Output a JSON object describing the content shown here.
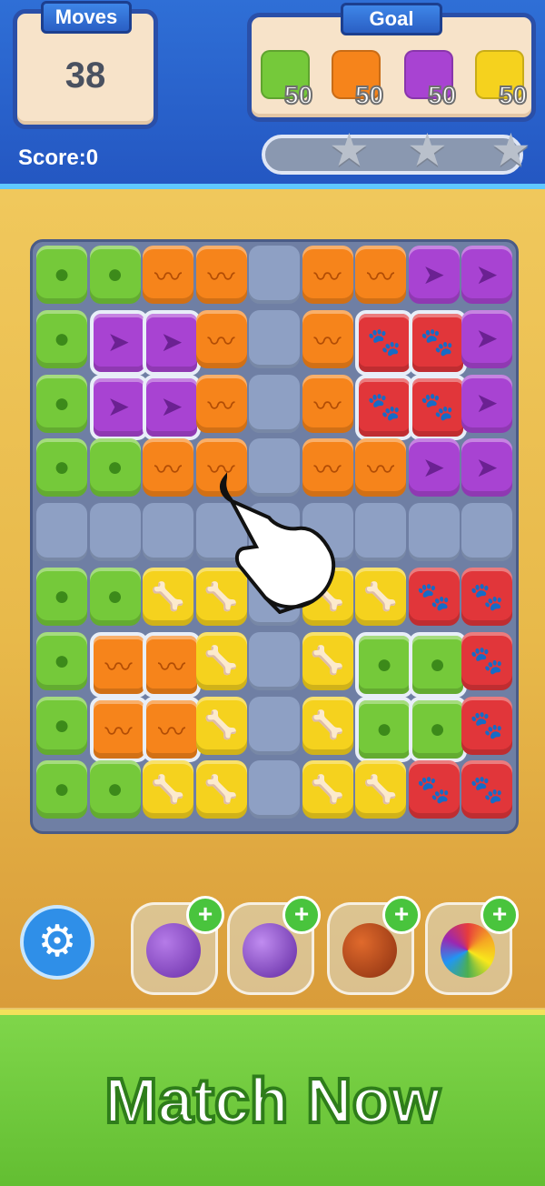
{
  "hud": {
    "moves_label": "Moves",
    "moves_value": "38",
    "goal_label": "Goal",
    "goals": [
      {
        "item": "green-ball",
        "count": "50"
      },
      {
        "item": "orange-bread",
        "count": "50"
      },
      {
        "item": "purple-bird",
        "count": "50"
      },
      {
        "item": "yellow-bone",
        "count": "50"
      }
    ],
    "score_label": "Score:0",
    "progress_fraction": 0,
    "stars": 3
  },
  "board": {
    "columns": 9,
    "rows": 9,
    "cells": [
      [
        "green",
        "green",
        "orange",
        "orange",
        "stone",
        "orange",
        "orange",
        "purple",
        "purple"
      ],
      [
        "green",
        "purple-ice",
        "purple-ice",
        "orange",
        "stone",
        "orange",
        "red-ice",
        "red-ice",
        "purple"
      ],
      [
        "green",
        "purple-ice",
        "purple-ice",
        "orange",
        "stone",
        "orange",
        "red-ice",
        "red-ice",
        "purple"
      ],
      [
        "green",
        "green",
        "orange",
        "orange",
        "stone",
        "orange",
        "orange",
        "purple",
        "purple"
      ],
      [
        "stone",
        "stone",
        "stone",
        "stone",
        "stone",
        "stone",
        "stone",
        "stone",
        "stone"
      ],
      [
        "green",
        "green",
        "yellow",
        "yellow",
        "stone",
        "yellow",
        "yellow",
        "red",
        "red"
      ],
      [
        "green",
        "orange-ice",
        "orange-ice",
        "yellow",
        "stone",
        "yellow",
        "green-ice",
        "green-ice",
        "red"
      ],
      [
        "green",
        "orange-ice",
        "orange-ice",
        "yellow",
        "stone",
        "yellow",
        "green-ice",
        "green-ice",
        "red"
      ],
      [
        "green",
        "green",
        "yellow",
        "yellow",
        "stone",
        "yellow",
        "yellow",
        "red",
        "red"
      ]
    ],
    "hint": "hand-pointer-icon"
  },
  "boosters": [
    {
      "icon": "rocket-ball-icon"
    },
    {
      "icon": "bomb-icon"
    },
    {
      "icon": "tnt-icon"
    },
    {
      "icon": "rainbow-flower-icon"
    }
  ],
  "cta": "Match Now"
}
